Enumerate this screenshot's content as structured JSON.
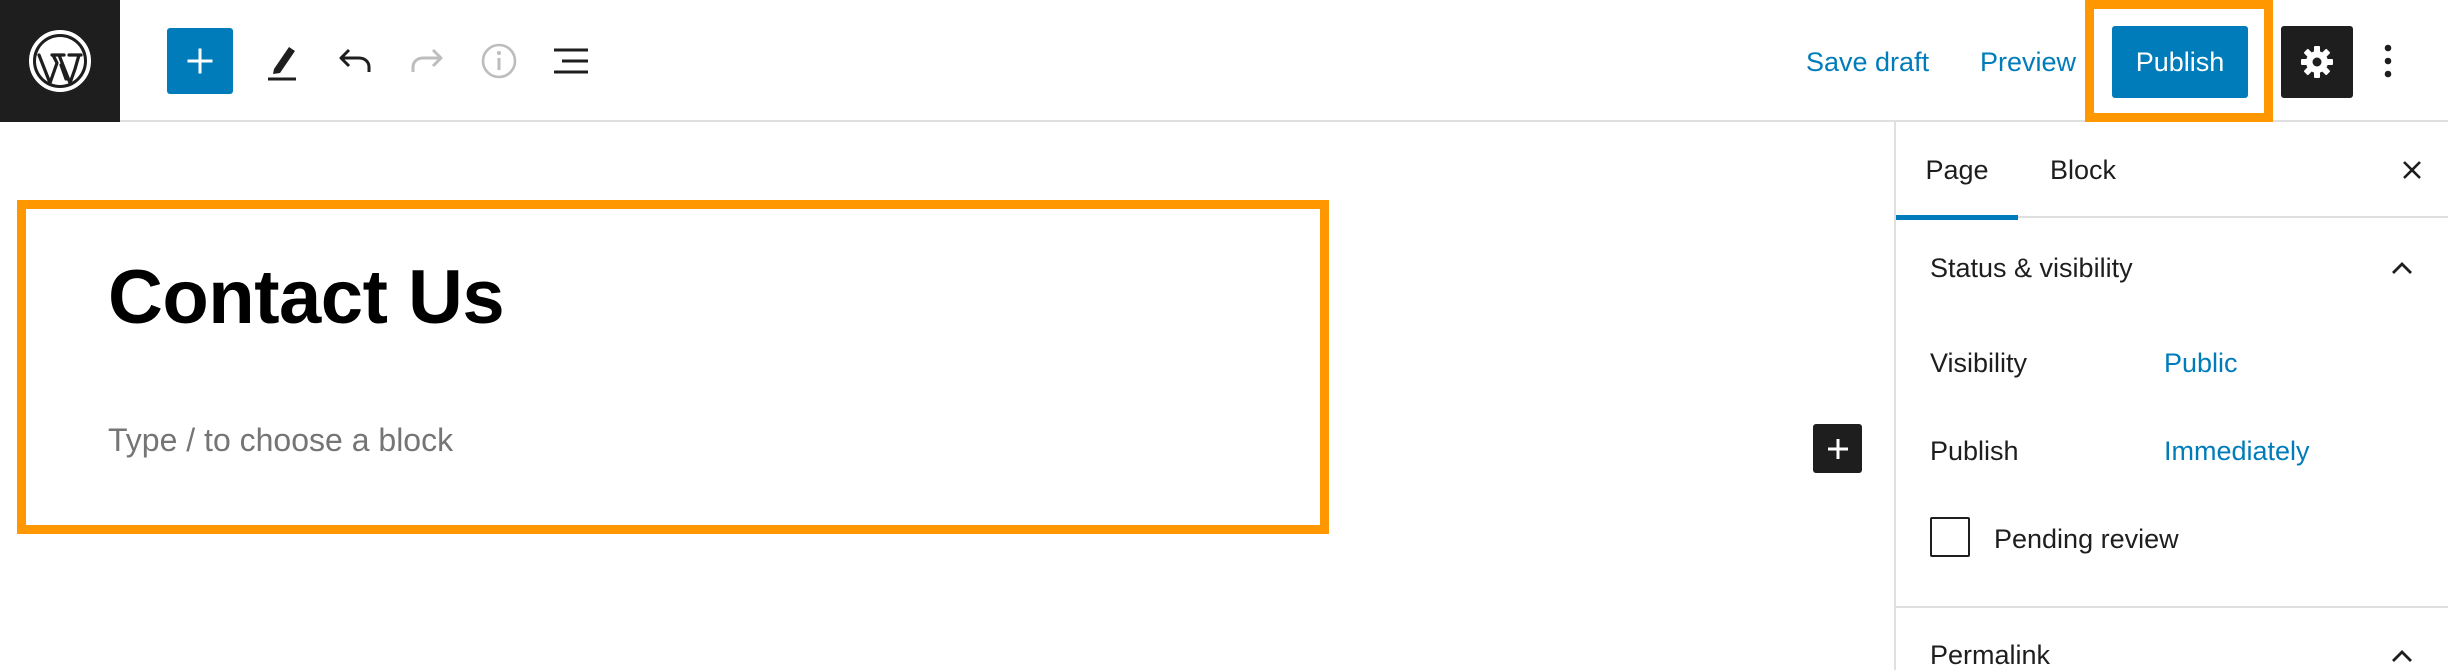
{
  "header": {
    "logo_icon": "wordpress-logo-icon",
    "tools": [
      {
        "name": "add-block",
        "icon": "plus-icon"
      },
      {
        "name": "tools",
        "icon": "pencil-icon"
      },
      {
        "name": "undo",
        "icon": "undo-icon"
      },
      {
        "name": "redo",
        "icon": "redo-icon"
      },
      {
        "name": "details",
        "icon": "info-icon"
      },
      {
        "name": "list-view",
        "icon": "list-view-icon"
      }
    ],
    "save_draft_label": "Save draft",
    "preview_label": "Preview",
    "publish_label": "Publish",
    "settings_icon": "gear-icon",
    "more_icon": "vertical-ellipsis-icon"
  },
  "editor": {
    "title": "Contact Us",
    "block_placeholder": "Type / to choose a block"
  },
  "sidebar": {
    "tabs": [
      {
        "label": "Page",
        "active": true
      },
      {
        "label": "Block",
        "active": false
      }
    ],
    "status_panel": {
      "title": "Status & visibility",
      "visibility_label": "Visibility",
      "visibility_value": "Public",
      "publish_label": "Publish",
      "publish_value": "Immediately",
      "pending_review_label": "Pending review",
      "pending_review_checked": false
    },
    "permalink_panel": {
      "title": "Permalink"
    }
  },
  "colors": {
    "accent": "#007cba",
    "dark": "#1e1e1e",
    "highlight": "#ff9800"
  }
}
